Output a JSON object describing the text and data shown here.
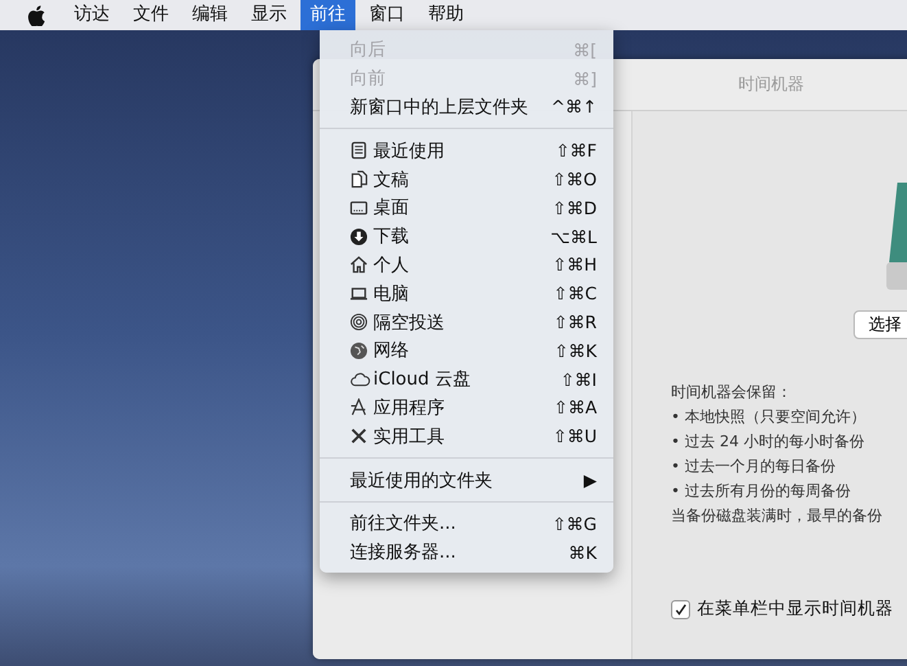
{
  "menu_bar": {
    "items": [
      {
        "label": "访达",
        "selected": false
      },
      {
        "label": "文件",
        "selected": false
      },
      {
        "label": "编辑",
        "selected": false
      },
      {
        "label": "显示",
        "selected": false
      },
      {
        "label": "前往",
        "selected": true
      },
      {
        "label": "窗口",
        "selected": false
      },
      {
        "label": "帮助",
        "selected": false
      }
    ]
  },
  "go_menu": {
    "sections": [
      [
        {
          "label": "向后",
          "shortcut": "⌘[",
          "disabled": true
        },
        {
          "label": "向前",
          "shortcut": "⌘]",
          "disabled": true
        },
        {
          "label": "新窗口中的上层文件夹",
          "shortcut": "^⌘↑",
          "disabled": false
        }
      ],
      [
        {
          "label": "最近使用",
          "shortcut": "⇧⌘F",
          "disabled": false
        },
        {
          "label": "文稿",
          "shortcut": "⇧⌘O",
          "disabled": false
        },
        {
          "label": "桌面",
          "shortcut": "⇧⌘D",
          "disabled": false
        },
        {
          "label": "下载",
          "shortcut": "⌥⌘L",
          "disabled": false
        },
        {
          "label": "个人",
          "shortcut": "⇧⌘H",
          "disabled": false
        },
        {
          "label": "电脑",
          "shortcut": "⇧⌘C",
          "disabled": false
        },
        {
          "label": "隔空投送",
          "shortcut": "⇧⌘R",
          "disabled": false
        },
        {
          "label": "网络",
          "shortcut": "⇧⌘K",
          "disabled": false
        },
        {
          "label": "iCloud 云盘",
          "shortcut": "⇧⌘I",
          "disabled": false
        },
        {
          "label": "应用程序",
          "shortcut": "⇧⌘A",
          "disabled": false
        },
        {
          "label": "实用工具",
          "shortcut": "⇧⌘U",
          "disabled": false
        }
      ],
      [
        {
          "label": "最近使用的文件夹",
          "shortcut": "▶",
          "disabled": false
        }
      ],
      [
        {
          "label": "前往文件夹...",
          "shortcut": "⇧⌘G",
          "disabled": false
        },
        {
          "label": "连接服务器...",
          "shortcut": "⌘K",
          "disabled": false
        }
      ]
    ]
  },
  "window": {
    "title": "时间机器",
    "select_button": "选择",
    "keeps_heading": "时间机器会保留：",
    "keeps_items": [
      "• 本地快照（只要空间允许）",
      "• 过去 24 小时的每小时备份",
      "• 过去一个月的每日备份",
      "• 过去所有月份的每周备份"
    ],
    "full_note": "当备份磁盘装满时，最早的备份",
    "show_in_menu_bar": {
      "label": "在菜单栏中显示时间机器",
      "checked": true
    }
  }
}
